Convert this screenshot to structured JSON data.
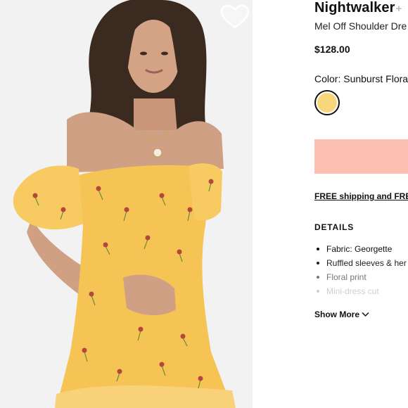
{
  "product": {
    "brand": "Nightwalker",
    "brand_suffix": "+",
    "name": "Mel Off Shoulder Dre",
    "price": "$128.00",
    "color_label": "Color: Sunburst Flora",
    "swatch_color": "#f7d67c",
    "cta_color": "#fbc0b0",
    "shipping_text": "FREE shipping and FRE"
  },
  "details": {
    "title": "DETAILS",
    "items": [
      "Fabric: Georgette",
      "Ruffled sleeves & her",
      "Floral print",
      "Mini-dress cut"
    ],
    "show_more": "Show More"
  },
  "icons": {
    "favorite": "heart-icon",
    "show_more": "chevron-down-icon"
  },
  "photo": {
    "background": "#f2f2f2",
    "dress_color": "#f6c355"
  }
}
